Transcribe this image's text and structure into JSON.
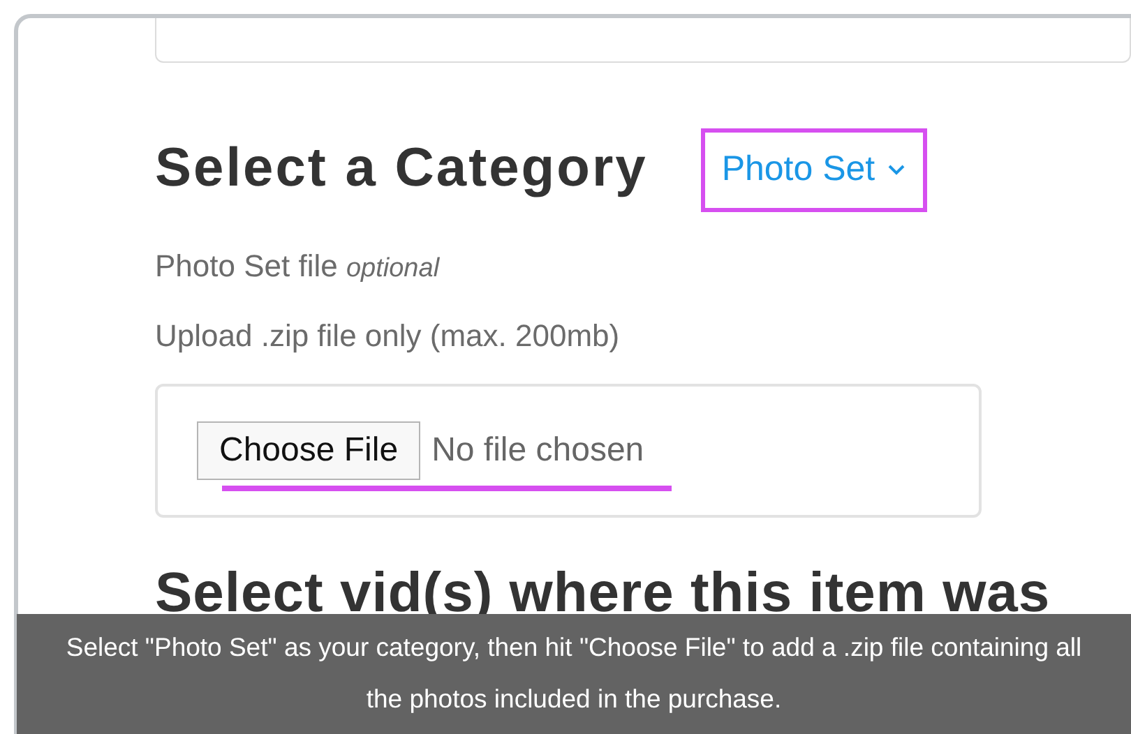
{
  "category_heading": "Select a Category",
  "category_dropdown": {
    "value": "Photo Set",
    "highlighted": true
  },
  "file_label": {
    "text": "Photo Set file",
    "hint": "optional"
  },
  "upload_note": "Upload .zip file only (max. 200mb)",
  "file_input": {
    "button": "Choose File",
    "status": "No file chosen",
    "underlined": true
  },
  "next_heading": "Select vid(s) where this item was",
  "caption": "Select \"Photo Set\" as your category, then hit \"Choose File\" to add a .zip file containing all the photos included in the purchase."
}
